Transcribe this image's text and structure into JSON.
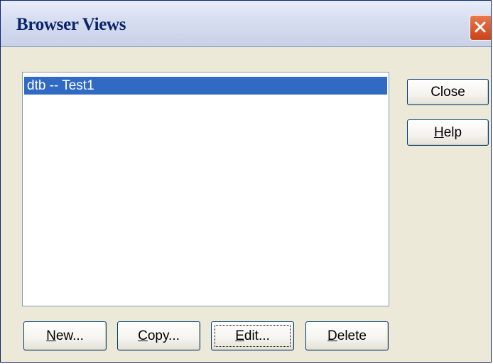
{
  "window": {
    "title": "Browser Views"
  },
  "list": {
    "items": [
      {
        "label": "dtb -- Test1",
        "selected": true
      }
    ]
  },
  "buttons": {
    "close": {
      "text": "Close",
      "mnemonic": "",
      "rest": "Close"
    },
    "help": {
      "mnemonic": "H",
      "rest": "elp"
    },
    "new": {
      "mnemonic": "N",
      "rest": "ew..."
    },
    "copy": {
      "mnemonic": "C",
      "rest": "opy..."
    },
    "edit": {
      "mnemonic": "E",
      "rest": "dit..."
    },
    "delete": {
      "mnemonic": "D",
      "rest": "elete"
    }
  },
  "colors": {
    "dialog_bg": "#ECE9D8",
    "selection": "#316AC5",
    "title_text": "#0A246A",
    "close_button": "#D95A30"
  },
  "icons": {
    "titlebar_close": "close-icon"
  }
}
